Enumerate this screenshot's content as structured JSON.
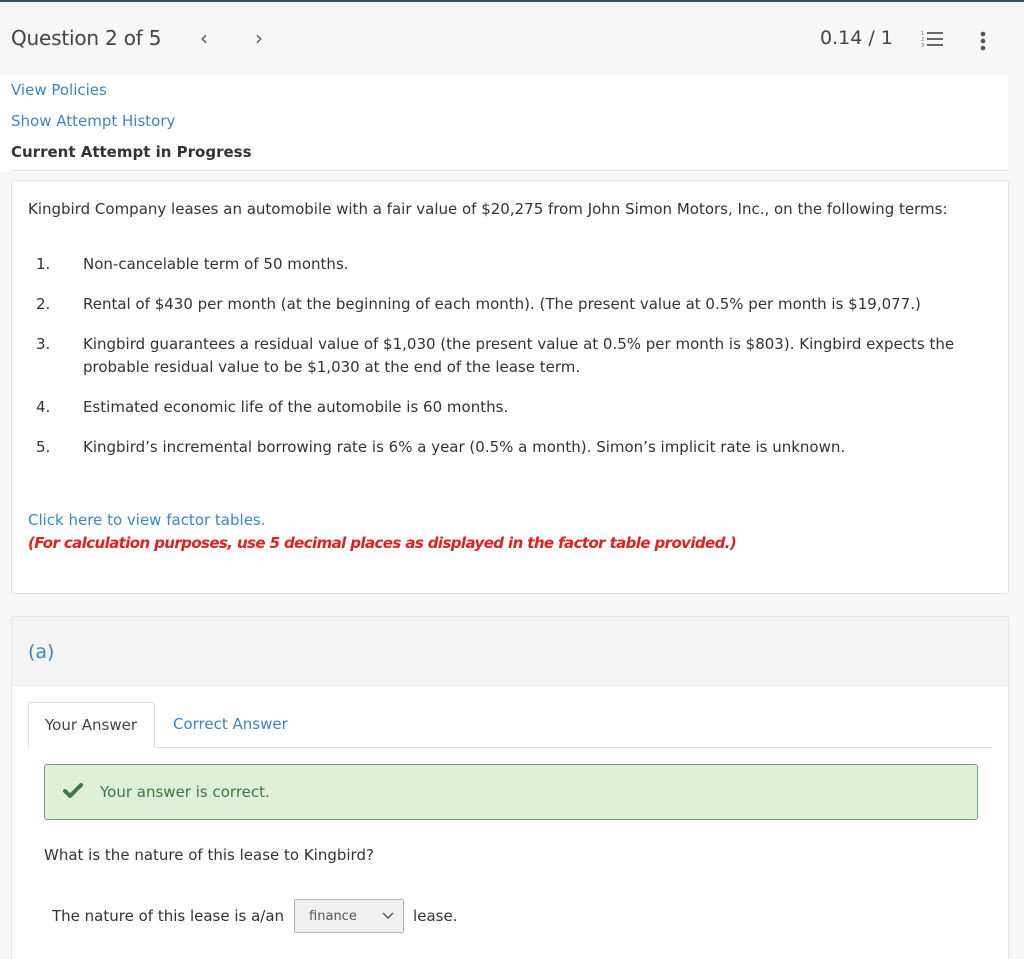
{
  "header": {
    "question_label": "Question 2 of 5",
    "prev_icon": "chevron-left-icon",
    "prev_glyph": "‹",
    "next_icon": "chevron-right-icon",
    "next_glyph": "›",
    "score": "0.14 / 1",
    "list_icon": "numbered-list-icon",
    "more_icon": "more-vertical-icon"
  },
  "meta": {
    "view_policies": "View Policies",
    "show_history": "Show Attempt History",
    "current_attempt": "Current Attempt in Progress"
  },
  "problem": {
    "intro": "Kingbird Company leases an automobile with a fair value of $20,275 from John Simon Motors, Inc., on the following terms:",
    "terms": [
      {
        "num": "1.",
        "text": "Non-cancelable term of 50 months."
      },
      {
        "num": "2.",
        "text": "Rental of $430 per month (at the beginning of each month). (The present value at 0.5% per month is $19,077.)"
      },
      {
        "num": "3.",
        "text": "Kingbird guarantees a residual value of $1,030 (the present value at 0.5% per month is $803). Kingbird expects the probable residual value to be $1,030 at the end of the lease term."
      },
      {
        "num": "4.",
        "text": "Estimated economic life of the automobile is 60 months."
      },
      {
        "num": "5.",
        "text": "Kingbird’s incremental borrowing rate is 6% a year (0.5% a month). Simon’s implicit rate is unknown."
      }
    ],
    "factor_link": "Click here to view factor tables.",
    "instruction": "(For calculation purposes, use 5 decimal places as displayed in the factor table provided.)"
  },
  "part_a": {
    "label": "(a)",
    "tabs": [
      {
        "label": "Your Answer",
        "active": true
      },
      {
        "label": "Correct Answer",
        "active": false
      }
    ],
    "success_message": "Your answer is correct.",
    "question": "What is the nature of this lease to Kingbird?",
    "answer_prefix": "The nature of this lease is a/an",
    "answer_select_value": "finance",
    "answer_suffix": "lease."
  },
  "colors": {
    "link": "#3b86c4",
    "instruction_red": "#e2211c",
    "success_bg": "#dff0d8",
    "success_text": "#3c763d",
    "header_border": "#3a4a6b"
  }
}
